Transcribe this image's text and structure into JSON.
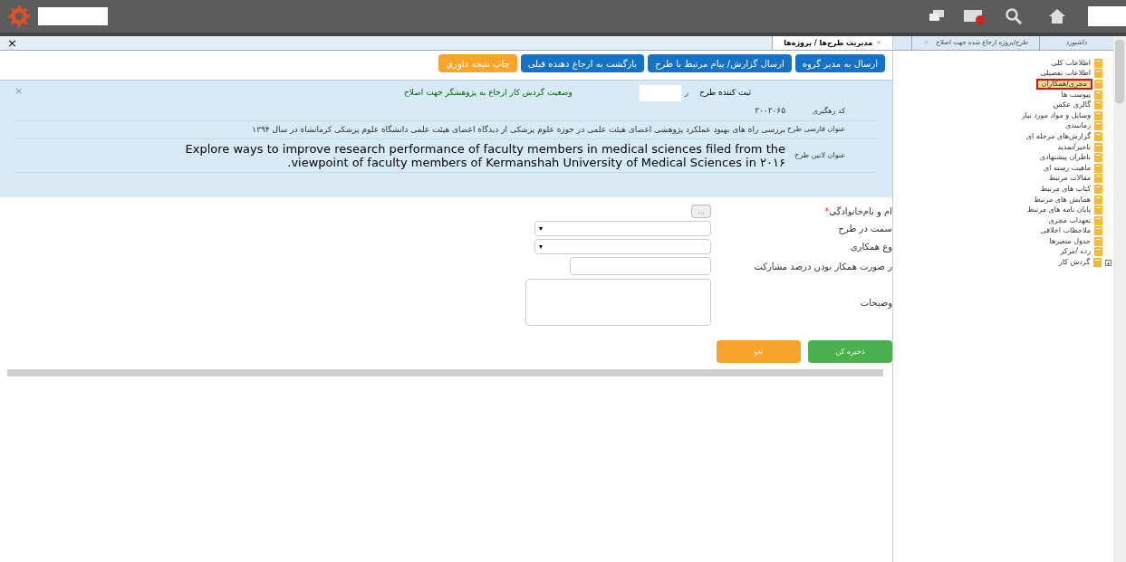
{
  "tabs": [
    {
      "label": "داشبورد",
      "selected": false,
      "closable": false
    },
    {
      "label": "طرح/پروژه ارجاع شده جهت اصلاح",
      "selected": false,
      "closable": true
    },
    {
      "label": "مدیریت طرح‌ها / پروژه‌ها",
      "selected": true,
      "closable": true
    }
  ],
  "tree": {
    "items": [
      {
        "label": "اطلاعات کلی",
        "selected": false
      },
      {
        "label": "اطلاعات تفصیلی",
        "selected": false
      },
      {
        "label": "مجری/همکاران",
        "selected": true
      },
      {
        "label": "پیوست ها",
        "selected": false
      },
      {
        "label": "گالری عکس",
        "selected": false
      },
      {
        "label": "وسایل و مواد مورد نیاز",
        "selected": false
      },
      {
        "label": "زمانبندی",
        "selected": false
      },
      {
        "label": "گزارش‌های مرحله ای",
        "selected": false
      },
      {
        "label": "تاخیر/تمدید",
        "selected": false
      },
      {
        "label": "ناظران پیشنهادی",
        "selected": false
      },
      {
        "label": "ماهیت رسته ای",
        "selected": false
      },
      {
        "label": "مقالات مرتبط",
        "selected": false
      },
      {
        "label": "کتاب های مرتبط",
        "selected": false
      },
      {
        "label": "همایش های مرتبط",
        "selected": false
      },
      {
        "label": "پایان نامه های مرتبط",
        "selected": false
      },
      {
        "label": "تعهدات مجری",
        "selected": false
      },
      {
        "label": "ملاحظات اخلاقی",
        "selected": false
      },
      {
        "label": "جدول متغیرها",
        "selected": false
      },
      {
        "label": "رده /مرکز",
        "selected": false
      },
      {
        "label": "گردش کار",
        "selected": false,
        "expandable": true
      }
    ]
  },
  "actions": [
    {
      "label": "ارسال به مدیر گروه",
      "kind": "primary"
    },
    {
      "label": "ارسال گزارش/ پیام مرتبط با طرح",
      "kind": "primary"
    },
    {
      "label": "بازگشت به ارجاع دهنده قبلی",
      "kind": "primary"
    },
    {
      "label": "چاپ نتیجه داوری",
      "kind": "warning"
    }
  ],
  "info": {
    "registrar_label": "ثبت کننده طرح",
    "registrar_fragment": "ر",
    "status": "وضعیت گردش کار ارجاع به پژوهشگر جهت اصلاح",
    "rows": [
      {
        "label": "کد رهگیری",
        "value": "۳۰۰۳۰۶۵",
        "kind": "plain"
      },
      {
        "label": "عنوان فارسی طرح",
        "value": "بررسی راه های بهبود عملکرد پژوهشی اعضای هیئت علمی در حوزه علوم پزشکی از دیدگاه اعضای هیئت علمی دانشگاه علوم پزشکی کرمانشاه در سال ۱۳۹۴",
        "kind": "plain"
      },
      {
        "label": "عنوان لاتین طرح",
        "value": "Explore ways to improve research performance of faculty members in medical sciences filed from the viewpoint of faculty members of Kermanshah University of Medical Sciences in ۲۰۱۶.",
        "kind": "large"
      }
    ]
  },
  "form": {
    "fields": [
      {
        "label": "ام و نام‌خانوادگی",
        "required": true,
        "kind": "lookup"
      },
      {
        "label": "سمت در طرح",
        "required": false,
        "kind": "select"
      },
      {
        "label": "وع همکاری",
        "required": false,
        "kind": "select"
      },
      {
        "label": "ر صورت همکار بودن درصد مشارکت",
        "required": false,
        "kind": "short"
      },
      {
        "label": "وضیحات",
        "required": false,
        "kind": "textarea"
      }
    ],
    "lookup_button": "...",
    "required_glyph": "*",
    "save": "ذخیره کن",
    "cancel": "لغو"
  },
  "close_glyph": "×",
  "dismiss_glyph": "×",
  "select_glyph": "▾",
  "expand_glyph": "+"
}
